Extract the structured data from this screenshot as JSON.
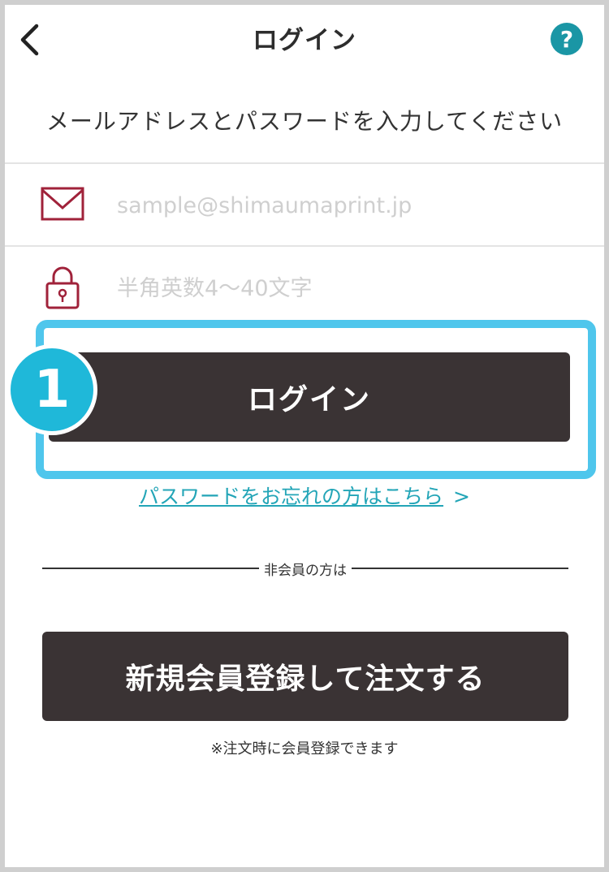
{
  "header": {
    "title": "ログイン",
    "back_icon": "chevron-left-icon",
    "help_label": "?",
    "help_color": "#1a96a5"
  },
  "instruction": "メールアドレスとパスワードを入力してください",
  "email_field": {
    "icon": "envelope-icon",
    "placeholder": "sample@shimaumaprint.jp",
    "value": ""
  },
  "password_field": {
    "icon": "lock-icon",
    "placeholder": "半角英数4〜40文字",
    "value": ""
  },
  "step_badge": "1",
  "login_button": "ログイン",
  "forgot_link": {
    "label": "パスワードをお忘れの方はこちら",
    "arrow": ">"
  },
  "separator_label": "非会員の方は",
  "signup_button": "新規会員登録して注文する",
  "signup_note": "※注文時に会員登録できます",
  "colors": {
    "highlight": "#4fc6ec",
    "button_bg": "#3a3334",
    "link": "#23a5b7",
    "accent_icon": "#a0223a"
  }
}
